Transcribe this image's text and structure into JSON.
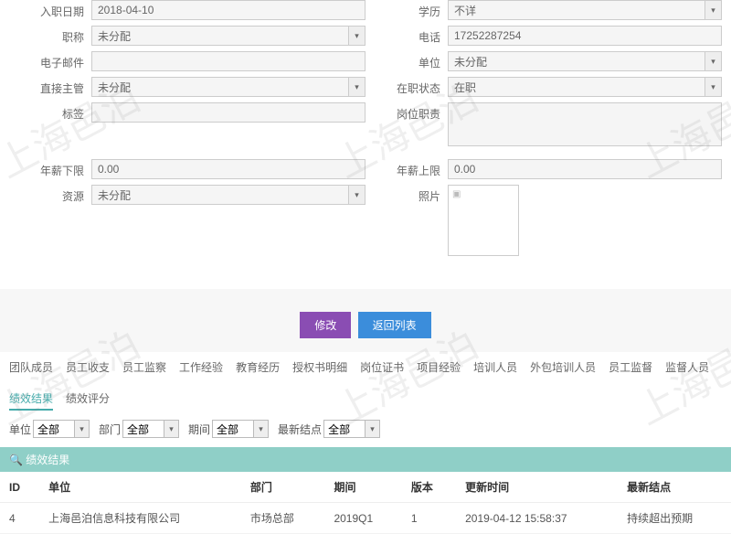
{
  "watermark": "上海邑泊",
  "form": {
    "hire_date": {
      "label": "入职日期",
      "value": "2018-04-10"
    },
    "education": {
      "label": "学历",
      "value": "不详"
    },
    "title": {
      "label": "职称",
      "value": "未分配"
    },
    "phone": {
      "label": "电话",
      "value": "17252287254"
    },
    "email": {
      "label": "电子邮件",
      "value": ""
    },
    "unit": {
      "label": "单位",
      "value": "未分配"
    },
    "supervisor": {
      "label": "直接主管",
      "value": "未分配"
    },
    "status": {
      "label": "在职状态",
      "value": "在职"
    },
    "tags": {
      "label": "标签",
      "value": ""
    },
    "job_desc": {
      "label": "岗位职责",
      "value": ""
    },
    "salary_min": {
      "label": "年薪下限",
      "value": "0.00"
    },
    "salary_max": {
      "label": "年薪上限",
      "value": "0.00"
    },
    "resource": {
      "label": "资源",
      "value": "未分配"
    },
    "photo": {
      "label": "照片"
    }
  },
  "buttons": {
    "edit": "修改",
    "back": "返回列表"
  },
  "tabs": [
    "团队成员",
    "员工收支",
    "员工监察",
    "工作经验",
    "教育经历",
    "授权书明细",
    "岗位证书",
    "项目经验",
    "培训人员",
    "外包培训人员",
    "员工监督",
    "监督人员",
    "绩效结果",
    "绩效评分"
  ],
  "active_tab_index": 12,
  "filters": {
    "unit": {
      "label": "单位",
      "value": "全部"
    },
    "dept": {
      "label": "部门",
      "value": "全部"
    },
    "period": {
      "label": "期间",
      "value": "全部"
    },
    "latest": {
      "label": "最新结点",
      "value": "全部"
    }
  },
  "section_title": "绩效结果",
  "search_icon": "🔍",
  "table": {
    "headers": [
      "ID",
      "单位",
      "部门",
      "期间",
      "版本",
      "更新时间",
      "最新结点"
    ],
    "rows": [
      {
        "id": "4",
        "unit": "上海邑泊信息科技有限公司",
        "dept": "市场总部",
        "period": "2019Q1",
        "version": "1",
        "updated": "2019-04-12 15:58:37",
        "latest": "持续超出预期"
      }
    ]
  },
  "caret": "▾",
  "photo_placeholder": "▣"
}
